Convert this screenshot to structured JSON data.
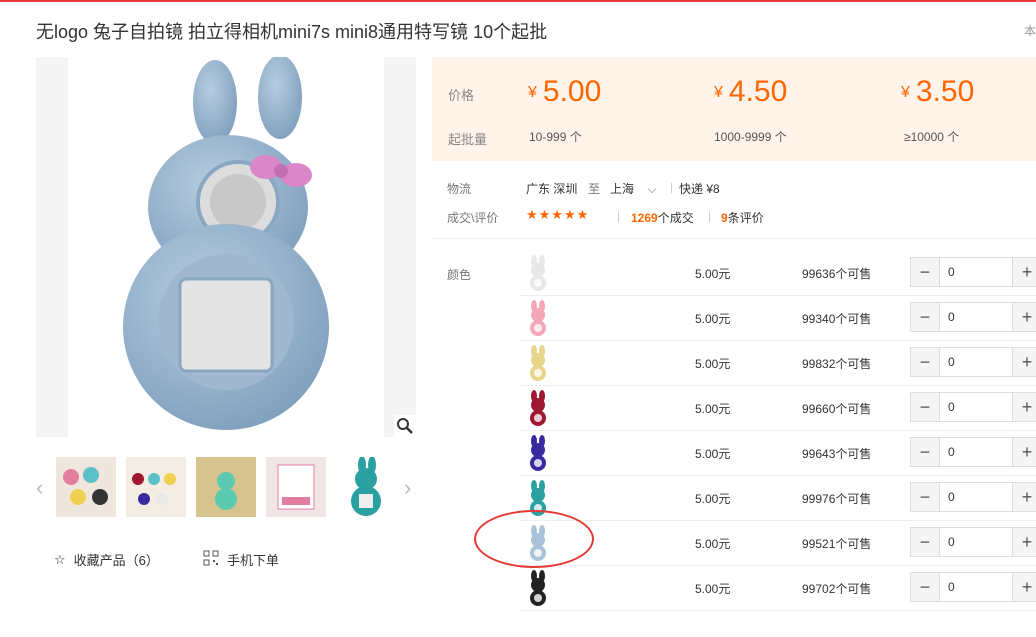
{
  "title": "无logo 兔子自拍镜 拍立得相机mini7s mini8通用特写镜 10个起批",
  "title_right": "本",
  "main_image": {
    "icon": "rabbit-selfie-mirror-blue"
  },
  "thumbnails": [
    "photo-1",
    "photo-2",
    "photo-3",
    "photo-4",
    "photo-5"
  ],
  "favorites": {
    "label": "收藏产品（6）"
  },
  "mobile_order": {
    "label": "手机下单"
  },
  "price": {
    "label": "价格",
    "moq_label": "起批量",
    "currency": "¥",
    "tiers": [
      {
        "price": "5.00",
        "range": "10-999 个"
      },
      {
        "price": "4.50",
        "range": "1000-9999 个"
      },
      {
        "price": "3.50",
        "range": "≥10000 个"
      }
    ]
  },
  "logistics": {
    "label": "物流",
    "from": "广东 深圳",
    "to_word": "至",
    "to": "上海",
    "express": "快递 ¥8"
  },
  "deals": {
    "label": "成交\\评价",
    "stars": "★★★★★",
    "deal_count": "1269",
    "deal_suffix": "个成交",
    "review_count": "9",
    "review_suffix": "条评价"
  },
  "sku": {
    "label": "颜色",
    "rows": [
      {
        "swatch": "white-rabbit",
        "color": "#e8e8e8",
        "price": "5.00元",
        "stock": "99636个可售",
        "qty": "0"
      },
      {
        "swatch": "pink-rabbit",
        "color": "#f4a7b9",
        "price": "5.00元",
        "stock": "99340个可售",
        "qty": "0"
      },
      {
        "swatch": "yellow-camera",
        "color": "#e6d58a",
        "price": "5.00元",
        "stock": "99832个可售",
        "qty": "0"
      },
      {
        "swatch": "red-rabbit",
        "color": "#a01830",
        "price": "5.00元",
        "stock": "99660个可售",
        "qty": "0"
      },
      {
        "swatch": "purple-rabbit",
        "color": "#3a2aa0",
        "price": "5.00元",
        "stock": "99643个可售",
        "qty": "0"
      },
      {
        "swatch": "teal-rabbit",
        "color": "#2aa0a0",
        "price": "5.00元",
        "stock": "99976个可售",
        "qty": "0"
      },
      {
        "swatch": "blue-rabbit",
        "color": "#a9c2d8",
        "price": "5.00元",
        "stock": "99521个可售",
        "qty": "0"
      },
      {
        "swatch": "black-rabbit",
        "color": "#222222",
        "price": "5.00元",
        "stock": "99702个可售",
        "qty": "0"
      }
    ],
    "minus": "−",
    "plus": "+"
  },
  "colors": {
    "accent": "#ff6600",
    "price_bg": "#fff3ea",
    "highlight_circle": "#e53935"
  }
}
